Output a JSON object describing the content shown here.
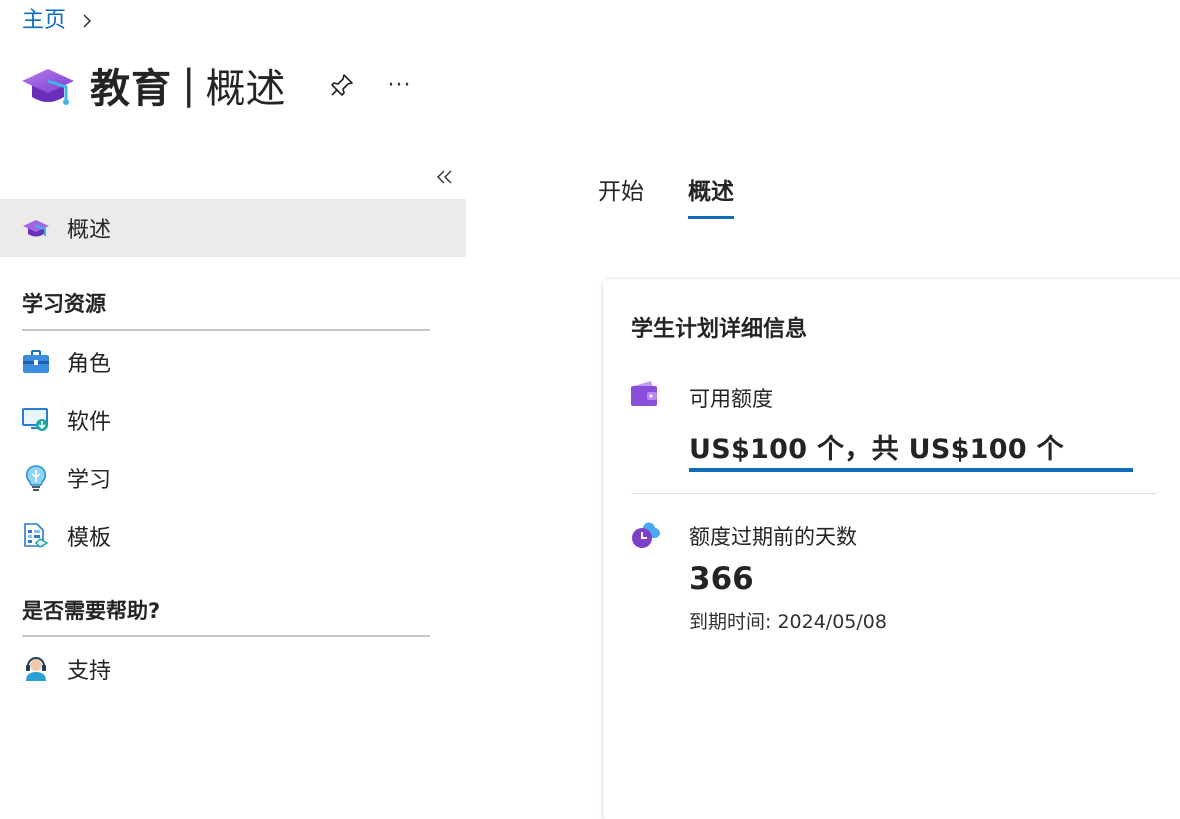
{
  "breadcrumb": {
    "home": "主页"
  },
  "header": {
    "title": "教育",
    "separator": "|",
    "subtitle": "概述",
    "more": "···"
  },
  "sidebar": {
    "overview": "概述",
    "section_learning": "学习资源",
    "roles": "角色",
    "software": "软件",
    "learn": "学习",
    "templates": "模板",
    "section_help": "是否需要帮助?",
    "support": "支持"
  },
  "tabs": [
    {
      "label": "开始"
    },
    {
      "label": "概述"
    }
  ],
  "card": {
    "title": "学生计划详细信息",
    "credit_label": "可用额度",
    "credit_value": "US$100 个，共 US$100 个",
    "credit_remaining_fraction": 1.0,
    "days_label": "额度过期前的天数",
    "days_value": "366",
    "expire_text": "到期时间: 2024/05/08"
  },
  "colors": {
    "accent": "#0f6cbd",
    "active_nav": "#edebe9",
    "divider": "#c8c6c4"
  }
}
